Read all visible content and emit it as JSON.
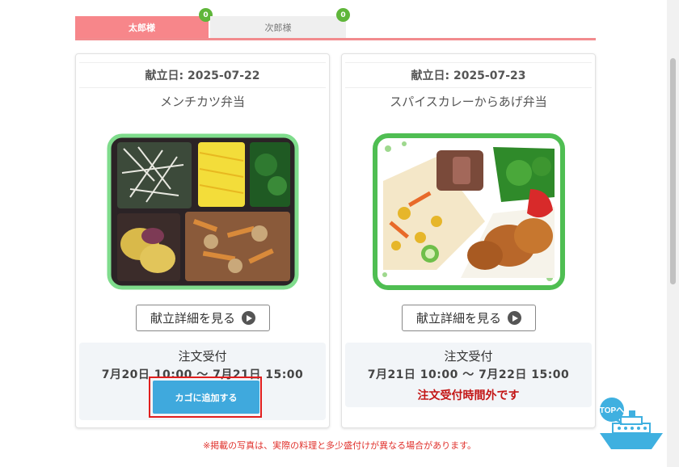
{
  "tabs": [
    {
      "label": "太郎様",
      "count": "0"
    },
    {
      "label": "次郎様",
      "count": "0"
    }
  ],
  "cards": [
    {
      "date": "献立日: 2025-07-22",
      "menu": "メンチカツ弁当",
      "detail_button": "献立詳細を見る",
      "order_title": "注文受付",
      "order_period": "7月20日 10:00 ～ 7月21日 15:00",
      "cart_button": "カゴに追加する"
    },
    {
      "date": "献立日: 2025-07-23",
      "menu": "スパイスカレーからあげ弁当",
      "detail_button": "献立詳細を見る",
      "order_title": "注文受付",
      "order_period": "7月21日 10:00 ～ 7月22日 15:00",
      "status": "注文受付時間外です"
    }
  ],
  "notice": "※掲載の写真は、実際の料理と多少盛付けが異なる場合があります。",
  "top_button": "TOPへ",
  "colors": {
    "tab_active": "#f7868a",
    "badge": "#5fb63a",
    "cart": "#3fa9dd",
    "closed": "#c31616"
  }
}
